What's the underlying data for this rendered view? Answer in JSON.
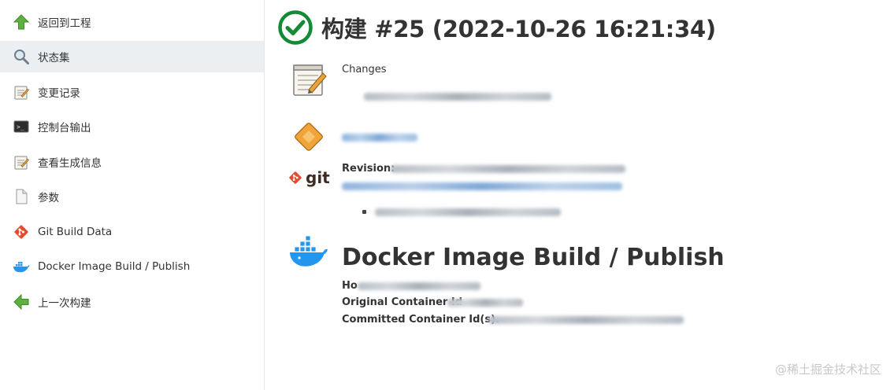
{
  "sidebar": {
    "items": [
      {
        "label": "返回到工程",
        "icon": "up-arrow-icon"
      },
      {
        "label": "状态集",
        "icon": "search-icon"
      },
      {
        "label": "变更记录",
        "icon": "notepad-icon"
      },
      {
        "label": "控制台输出",
        "icon": "terminal-icon"
      },
      {
        "label": "查看生成信息",
        "icon": "notepad-icon"
      },
      {
        "label": "参数",
        "icon": "document-icon"
      },
      {
        "label": "Git Build Data",
        "icon": "git-icon"
      },
      {
        "label": "Docker Image Build / Publish",
        "icon": "docker-icon"
      },
      {
        "label": "上一次构建",
        "icon": "left-arrow-icon"
      }
    ]
  },
  "build": {
    "title": "构建 #25 (2022-10-26 16:21:34)",
    "status_color": "#138a36"
  },
  "changes": {
    "label": "Changes"
  },
  "git": {
    "logo_text": "git",
    "revision_label": "Revision:"
  },
  "docker": {
    "heading": "Docker Image Build / Publish",
    "host_label": "Ho",
    "original_container_label": "Original Container Id",
    "committed_container_label": "Committed Container Id(s)."
  },
  "watermark": "@稀土掘金技术社区"
}
